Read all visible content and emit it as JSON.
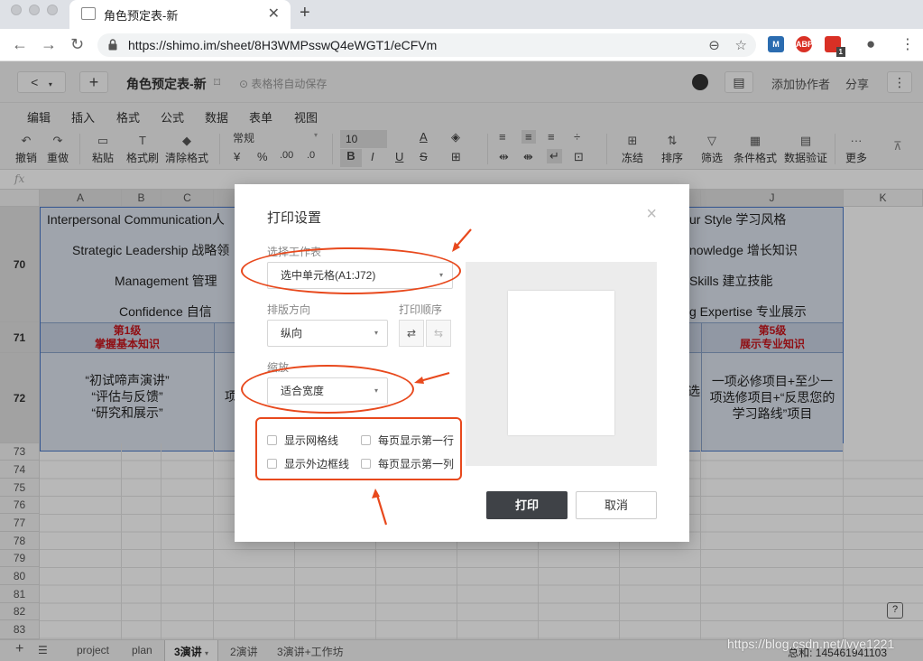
{
  "browser": {
    "tab_title": "角色预定表-新",
    "url": "https://shimo.im/sheet/8H3WMPsswQ4eWGT1/eCFVm",
    "ext_badge": "1"
  },
  "header": {
    "back": "<",
    "add": "+",
    "doc_title": "角色预定表-新",
    "autosave": "表格将自动保存",
    "add_collaborator": "添加协作者",
    "share": "分享",
    "more": "⋮"
  },
  "menu": [
    "编辑",
    "插入",
    "格式",
    "公式",
    "数据",
    "表单",
    "视图"
  ],
  "toolbar": {
    "undo": "撤销",
    "redo": "重做",
    "paste": "粘贴",
    "format_painter": "格式刷",
    "clear_format": "清除格式",
    "number_format": "常规",
    "currency": "¥",
    "percent": "%",
    "decimal_inc": ".00",
    "decimal_dec": ".0",
    "font_size": "10",
    "bold": "B",
    "italic": "I",
    "underline": "U",
    "strike": "S",
    "freeze": "冻结",
    "sort": "排序",
    "filter": "筛选",
    "cond_format": "条件格式",
    "data_validation": "数据验证",
    "more": "更多"
  },
  "formula_bar": {
    "fx": "fx"
  },
  "sheet": {
    "columns": [
      "A",
      "B",
      "C",
      "J",
      "K"
    ],
    "row_70_lines": {
      "left": [
        "Interpersonal Communication人",
        "Strategic Leadership 战略领",
        "Management 管理",
        "Confidence 自信"
      ],
      "right": [
        "ur Style 学习风格",
        "nowledge 增长知识",
        "Skills 建立技能",
        "g Expertise 专业展示"
      ]
    },
    "row_71": {
      "left_l1": "第1级",
      "left_l2": "掌握基本知识",
      "right_l1": "第5级",
      "right_l2": "展示专业知识"
    },
    "row_72": {
      "left": [
        "“初试啼声演讲”",
        "“评估与反馈”",
        "“研究和展示”"
      ],
      "left_partial": "项",
      "right_partial": "选",
      "right": [
        "一项必修项目+至少一",
        "项选修项目+“反思您的",
        "学习路线”项目"
      ]
    },
    "row_numbers": [
      "70",
      "71",
      "72",
      "73",
      "74",
      "75",
      "76",
      "77",
      "78",
      "79",
      "80",
      "81",
      "82",
      "83"
    ]
  },
  "dialog": {
    "title": "打印设置",
    "close": "×",
    "select_sheet_label": "选择工作表",
    "select_sheet_value": "选中单元格(A1:J72)",
    "orientation_label": "排版方向",
    "orientation_value": "纵向",
    "print_order_label": "打印顺序",
    "scale_label": "缩放",
    "scale_value": "适合宽度",
    "options": [
      "显示网格线",
      "每页显示第一行",
      "显示外边框线",
      "每页显示第一列"
    ],
    "print_button": "打印",
    "cancel_button": "取消"
  },
  "sheet_tabs": {
    "tabs": [
      "project",
      "plan",
      "3演讲",
      "2演讲",
      "3演讲+工作坊"
    ],
    "active": "3演讲",
    "sum": "总和: 145461941103"
  },
  "watermark": "https://blog.csdn.net/lvye1221",
  "colors": {
    "accent_annotation": "#e8491d",
    "selection_fill": "#dde4ef",
    "header_red": "#c8161d",
    "print_button": "#3f4247"
  }
}
